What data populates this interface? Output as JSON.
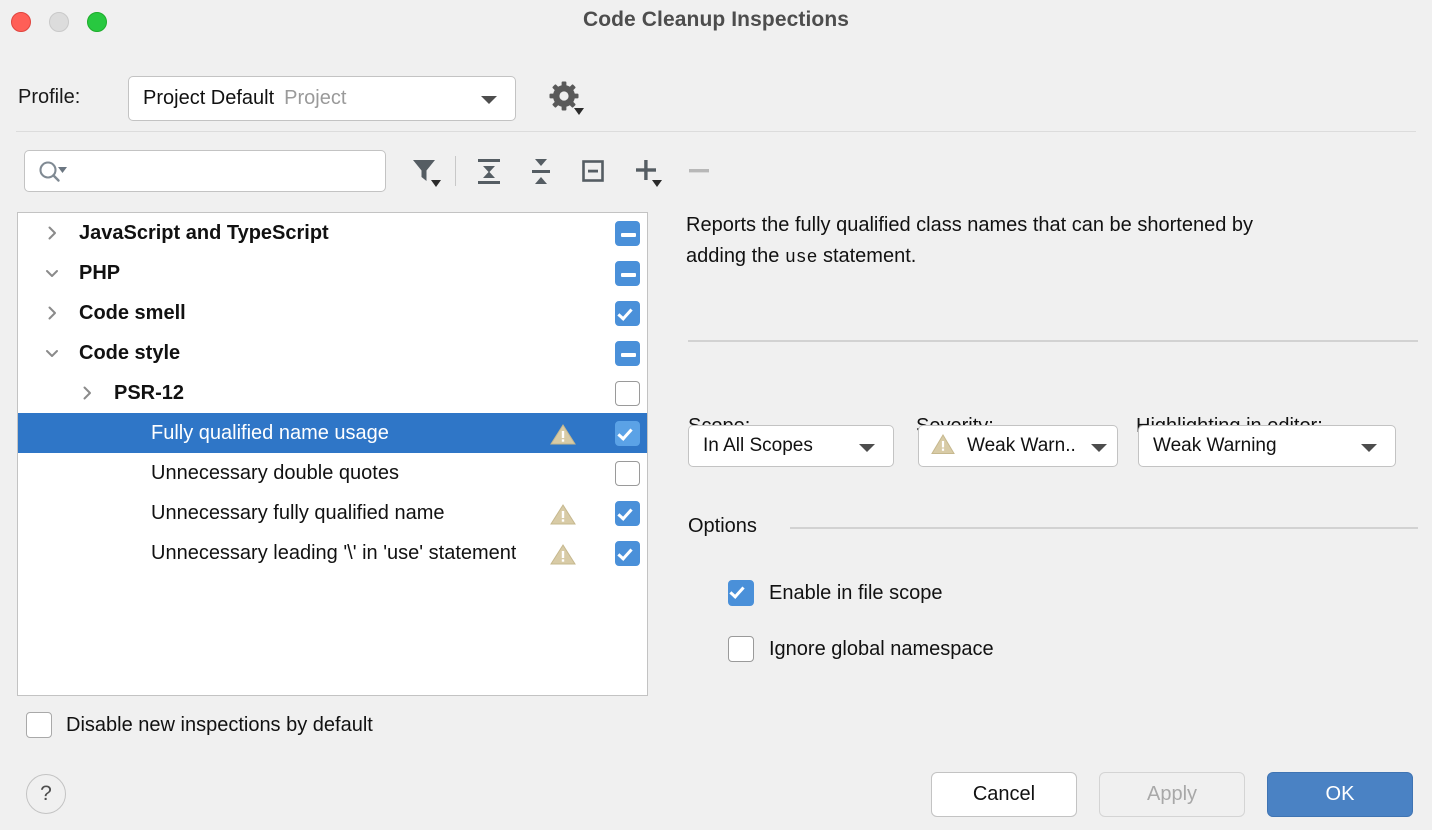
{
  "window": {
    "title": "Code Cleanup Inspections",
    "traffic_lights": [
      "close-button",
      "minimize-button",
      "maximize-button"
    ],
    "colors": {
      "close": "#ff5f57",
      "minimize": "#dcdcdc",
      "maximize": "#28c840",
      "accent": "#4a90d9",
      "selection": "#2f76c7",
      "default_button": "#4a82c4",
      "warning_icon": "#d8cba6"
    }
  },
  "profile": {
    "label": "Profile:",
    "value": "Project Default",
    "scope_suffix": "Project",
    "settings_icon": "gear-icon"
  },
  "toolbar": {
    "search_placeholder": "",
    "search_value": "",
    "buttons": [
      {
        "name": "filter-icon",
        "label": "Filter inspections"
      },
      {
        "name": "expand-all-icon",
        "label": "Expand All"
      },
      {
        "name": "collapse-all-icon",
        "label": "Collapse All"
      },
      {
        "name": "reset-to-empty-icon",
        "label": "Reset to Empty"
      },
      {
        "name": "add-icon",
        "label": "Add Scope"
      },
      {
        "name": "remove-icon",
        "label": "Remove Scope"
      }
    ]
  },
  "tree": {
    "rows": [
      {
        "label": "JavaScript and TypeScript",
        "depth": 0,
        "bold": true,
        "expander": "chevron-right-icon",
        "check": "partial",
        "warning": false,
        "selected": false
      },
      {
        "label": "PHP",
        "depth": 0,
        "bold": true,
        "expander": "chevron-down-icon",
        "check": "partial",
        "warning": false,
        "selected": false
      },
      {
        "label": "Code smell",
        "depth": 1,
        "bold": true,
        "expander": "chevron-right-icon",
        "check": "checked",
        "warning": false,
        "selected": false
      },
      {
        "label": "Code style",
        "depth": 1,
        "bold": true,
        "expander": "chevron-down-icon",
        "check": "partial",
        "warning": false,
        "selected": false
      },
      {
        "label": "PSR-12",
        "depth": 2,
        "bold": true,
        "expander": "chevron-right-icon",
        "check": "unchecked",
        "warning": false,
        "selected": false
      },
      {
        "label": "Fully qualified name usage",
        "depth": 3,
        "bold": false,
        "expander": "none",
        "check": "checked",
        "warning": true,
        "selected": true
      },
      {
        "label": "Unnecessary double quotes",
        "depth": 3,
        "bold": false,
        "expander": "none",
        "check": "unchecked",
        "warning": false,
        "selected": false
      },
      {
        "label": "Unnecessary fully qualified name",
        "depth": 3,
        "bold": false,
        "expander": "none",
        "check": "checked",
        "warning": true,
        "selected": false
      },
      {
        "label": "Unnecessary leading '\\' in 'use' statement",
        "depth": 3,
        "bold": false,
        "expander": "none",
        "check": "checked",
        "warning": true,
        "selected": false
      }
    ]
  },
  "disable_new": {
    "label": "Disable new inspections by default",
    "checked": false
  },
  "detail": {
    "description_part1": "Reports the fully qualified class names that can be shortened by adding the ",
    "description_code": "use",
    "description_part2": " statement.",
    "scope": {
      "label": "Scope:",
      "value": "In All Scopes"
    },
    "severity": {
      "label": "Severity:",
      "value": "Weak Warn..",
      "icon": "warning-triangle-icon"
    },
    "highlighting": {
      "label": "Highlighting in editor:",
      "value": "Weak Warning"
    },
    "options_title": "Options",
    "options": [
      {
        "label": "Enable in file scope",
        "checked": true
      },
      {
        "label": "Ignore global namespace",
        "checked": false
      }
    ]
  },
  "footer": {
    "help_label": "?",
    "cancel_label": "Cancel",
    "apply_label": "Apply",
    "apply_disabled": true,
    "ok_label": "OK"
  }
}
